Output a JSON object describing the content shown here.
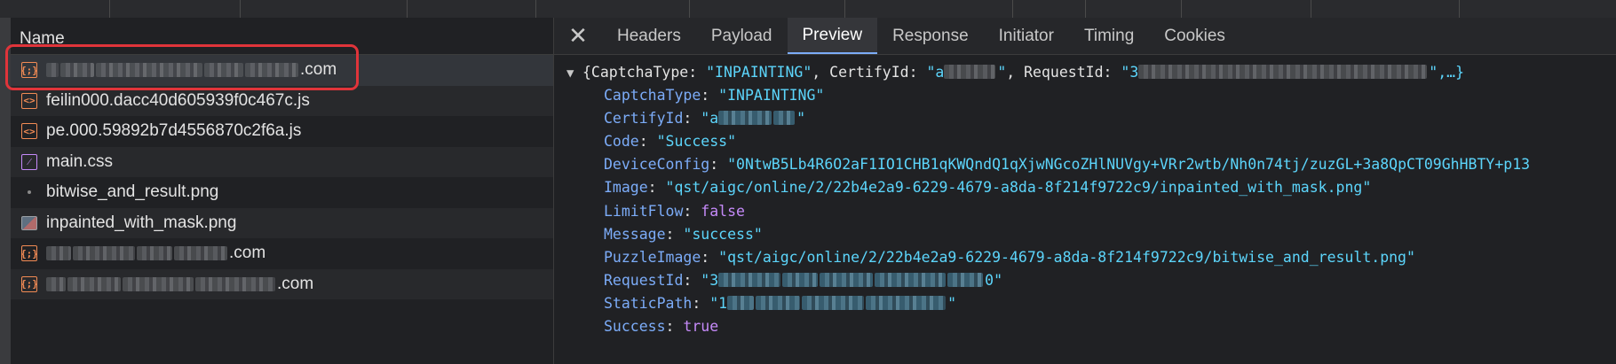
{
  "top_strip_ticks": [
    123,
    270,
    458,
    603,
    776,
    951,
    1140,
    1222,
    1330,
    1476,
    1643
  ],
  "left_panel": {
    "header": "Name",
    "requests": [
      {
        "icon": "xhr",
        "icon_glyph": "{;}",
        "blurred": true,
        "blur_widths": [
          14,
          38,
          120,
          44,
          60
        ],
        "suffix": ".com",
        "selected": true
      },
      {
        "icon": "js",
        "icon_glyph": "<>",
        "name": "feilin000.dacc40d605939f0c467c.js"
      },
      {
        "icon": "js",
        "icon_glyph": "<>",
        "name": "pe.000.59892b7d4556870c2f6a.js"
      },
      {
        "icon": "css",
        "icon_glyph": "⁄",
        "name": "main.css"
      },
      {
        "icon": "img-dot",
        "name": "bitwise_and_result.png"
      },
      {
        "icon": "img",
        "name": "inpainted_with_mask.png"
      },
      {
        "icon": "xhr",
        "icon_glyph": "{;}",
        "blurred": true,
        "blur_widths": [
          28,
          70,
          40,
          60
        ],
        "suffix": ".com"
      },
      {
        "icon": "xhr",
        "icon_glyph": "{;}",
        "blurred": true,
        "blur_widths": [
          22,
          60,
          80,
          90
        ],
        "suffix": ".com"
      }
    ]
  },
  "detail": {
    "close_glyph": "✕",
    "tabs": [
      "Headers",
      "Payload",
      "Preview",
      "Response",
      "Initiator",
      "Timing",
      "Cookies"
    ],
    "active_tab": "Preview",
    "summary": {
      "triangle": "▼",
      "open": "{CaptchaType: ",
      "captcha_value": "\"INPAINTING\"",
      "certify_key": ", CertifyId: ",
      "certify_start": "\"a",
      "certify_end": "\"",
      "request_key": ", RequestId: ",
      "request_start": "\"3",
      "request_end": "\",…}"
    },
    "properties": [
      {
        "key": "CaptchaType",
        "type": "string",
        "value": "\"INPAINTING\""
      },
      {
        "key": "CertifyId",
        "type": "string-blur",
        "value_start": "\"a",
        "value_end": "\"",
        "blur_widths": [
          60,
          24
        ]
      },
      {
        "key": "Code",
        "type": "string",
        "value": "\"Success\""
      },
      {
        "key": "DeviceConfig",
        "type": "string",
        "value": "\"0NtwB5Lb4R6O2aF1IO1CHB1qKWQndQ1qXjwNGcoZHlNUVgy+VRr2wtb/Nh0n74tj/zuzGL+3a8QpCT09GhHBTY+p13"
      },
      {
        "key": "Image",
        "type": "string",
        "value": "\"qst/aigc/online/2/22b4e2a9-6229-4679-a8da-8f214f9722c9/inpainted_with_mask.png\""
      },
      {
        "key": "LimitFlow",
        "type": "keyword",
        "value": "false"
      },
      {
        "key": "Message",
        "type": "string",
        "value": "\"success\""
      },
      {
        "key": "PuzzleImage",
        "type": "string",
        "value": "\"qst/aigc/online/2/22b4e2a9-6229-4679-a8da-8f214f9722c9/bitwise_and_result.png\""
      },
      {
        "key": "RequestId",
        "type": "string-blur",
        "value_start": "\"3",
        "value_end": "0\"",
        "blur_widths": [
          70,
          40,
          60,
          80,
          40
        ]
      },
      {
        "key": "StaticPath",
        "type": "string-blur",
        "value_start": "\"1",
        "value_end": "\"",
        "blur_widths": [
          30,
          50,
          70,
          90
        ]
      },
      {
        "key": "Success",
        "type": "keyword",
        "value": "true"
      }
    ]
  },
  "colors": {
    "key": "#7cacf8",
    "string": "#5cd5fb",
    "keyword": "#c58af9",
    "highlight_box": "#e0343a",
    "active_tab_underline": "#7cacf8"
  }
}
